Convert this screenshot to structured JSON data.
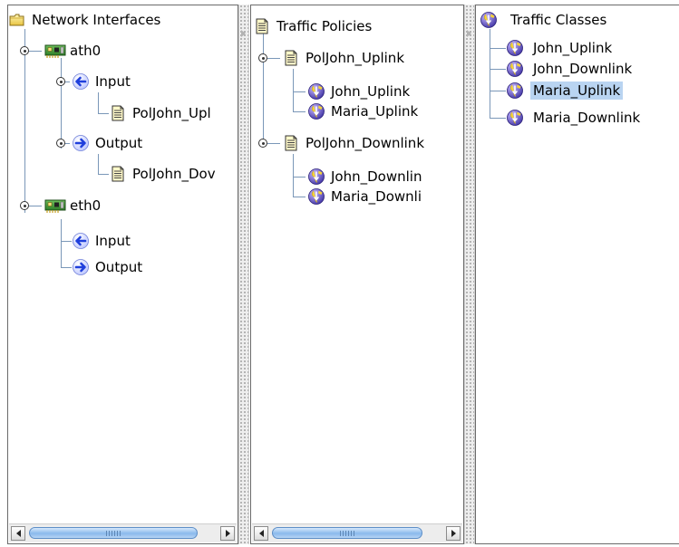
{
  "pane1": {
    "root_label": "Network Interfaces",
    "ath0": {
      "label": "ath0",
      "input_label": "Input",
      "input_policy": "PolJohn_Upl",
      "output_label": "Output",
      "output_policy": "PolJohn_Dov"
    },
    "eth0": {
      "label": "eth0",
      "input_label": "Input",
      "output_label": "Output"
    }
  },
  "pane2": {
    "root_label": "Traffic Policies",
    "uplink": {
      "label": "PolJohn_Uplink",
      "children": [
        "John_Uplink",
        "Maria_Uplink"
      ]
    },
    "downlink": {
      "label": "PolJohn_Downlink",
      "children": [
        "John_Downlin",
        "Maria_Downli"
      ]
    }
  },
  "pane3": {
    "root_label": "Traffic Classes",
    "items": [
      "John_Uplink",
      "John_Downlink",
      "Maria_Uplink",
      "Maria_Downlink"
    ],
    "selected": "Maria_Uplink"
  },
  "colors": {
    "selection": "#b9d4f1",
    "tree_line": "#7a97b8",
    "scroll_thumb": "#8ab9ec"
  }
}
